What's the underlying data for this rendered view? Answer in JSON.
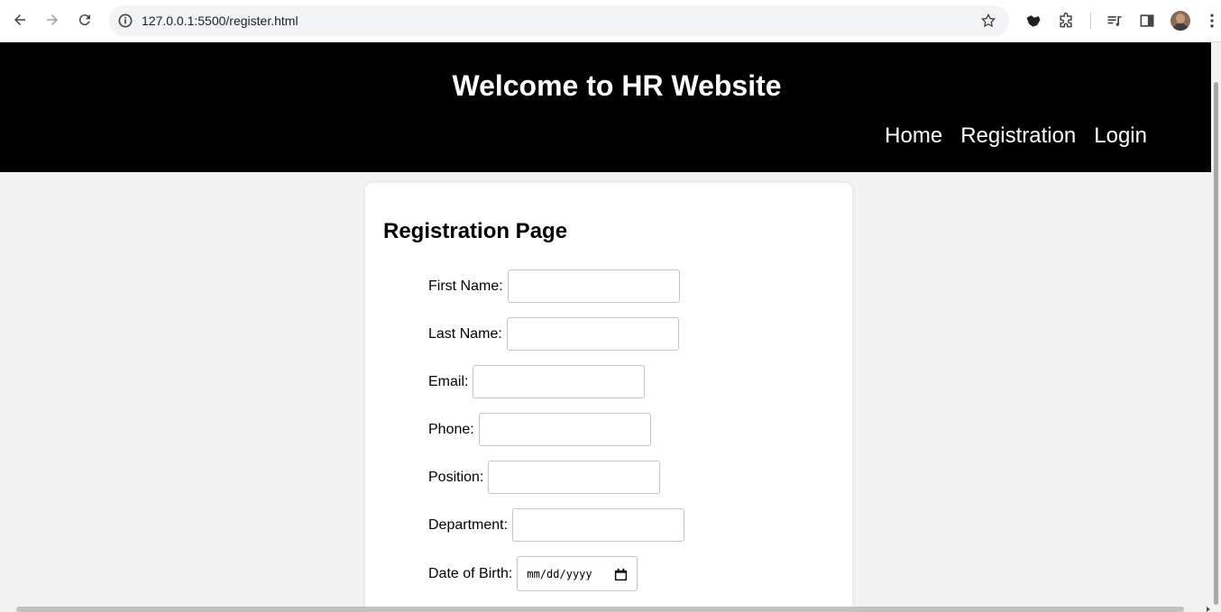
{
  "browser": {
    "url": "127.0.0.1:5500/register.html"
  },
  "header": {
    "title": "Welcome to HR Website",
    "nav": [
      "Home",
      "Registration",
      "Login"
    ]
  },
  "form": {
    "heading": "Registration Page",
    "fields": {
      "first_name": "First Name:",
      "last_name": "Last Name:",
      "email": "Email:",
      "phone": "Phone:",
      "position": "Position:",
      "department": "Department:",
      "dob": "Date of Birth:"
    },
    "dob_placeholder": "mm/dd/yyyy"
  },
  "colors": {
    "header_bg": "#000000",
    "page_bg": "#f2f2f2",
    "card_bg": "#ffffff"
  }
}
